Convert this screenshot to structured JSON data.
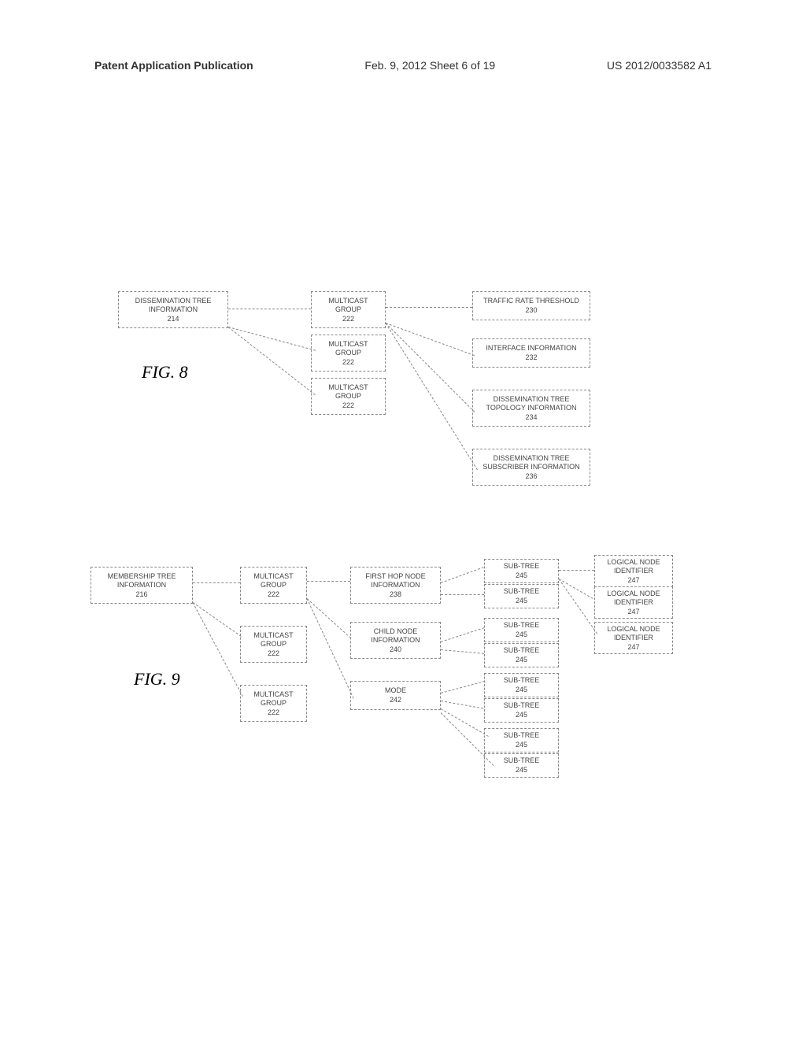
{
  "header": {
    "left": "Patent Application Publication",
    "center": "Feb. 9, 2012  Sheet 6 of 19",
    "right": "US 2012/0033582 A1"
  },
  "fig8": {
    "label": "FIG. 8",
    "boxes": {
      "dissem_tree_info": {
        "title": "DISSEMINATION TREE INFORMATION",
        "num": "214"
      },
      "mcast1": {
        "title": "MULTICAST GROUP",
        "num": "222"
      },
      "mcast2": {
        "title": "MULTICAST GROUP",
        "num": "222"
      },
      "mcast3": {
        "title": "MULTICAST GROUP",
        "num": "222"
      },
      "traffic": {
        "title": "TRAFFIC RATE THRESHOLD",
        "num": "230"
      },
      "interface": {
        "title": "INTERFACE INFORMATION",
        "num": "232"
      },
      "topology": {
        "title": "DISSEMINATION TREE TOPOLOGY INFORMATION",
        "num": "234"
      },
      "subscriber": {
        "title": "DISSEMINATION TREE SUBSCRIBER INFORMATION",
        "num": "236"
      }
    }
  },
  "fig9": {
    "label": "FIG. 9",
    "boxes": {
      "membership": {
        "title": "MEMBERSHIP TREE INFORMATION",
        "num": "216"
      },
      "mcast1": {
        "title": "MULTICAST GROUP",
        "num": "222"
      },
      "mcast2": {
        "title": "MULTICAST GROUP",
        "num": "222"
      },
      "mcast3": {
        "title": "MULTICAST GROUP",
        "num": "222"
      },
      "firsthop": {
        "title": "FIRST HOP NODE INFORMATION",
        "num": "238"
      },
      "childnode": {
        "title": "CHILD NODE INFORMATION",
        "num": "240"
      },
      "mode": {
        "title": "MODE",
        "num": "242"
      },
      "subtree1": {
        "title": "SUB-TREE",
        "num": "245"
      },
      "subtree2": {
        "title": "SUB-TREE",
        "num": "245"
      },
      "subtree3": {
        "title": "SUB-TREE",
        "num": "245"
      },
      "subtree4": {
        "title": "SUB-TREE",
        "num": "245"
      },
      "subtree5": {
        "title": "SUB-TREE",
        "num": "245"
      },
      "subtree6": {
        "title": "SUB-TREE",
        "num": "245"
      },
      "subtree7": {
        "title": "SUB-TREE",
        "num": "245"
      },
      "subtree8": {
        "title": "SUB-TREE",
        "num": "245"
      },
      "logical1": {
        "title": "LOGICAL NODE IDENTIFIER",
        "num": "247"
      },
      "logical2": {
        "title": "LOGICAL NODE IDENTIFIER",
        "num": "247"
      },
      "logical3": {
        "title": "LOGICAL NODE IDENTIFIER",
        "num": "247"
      }
    }
  }
}
